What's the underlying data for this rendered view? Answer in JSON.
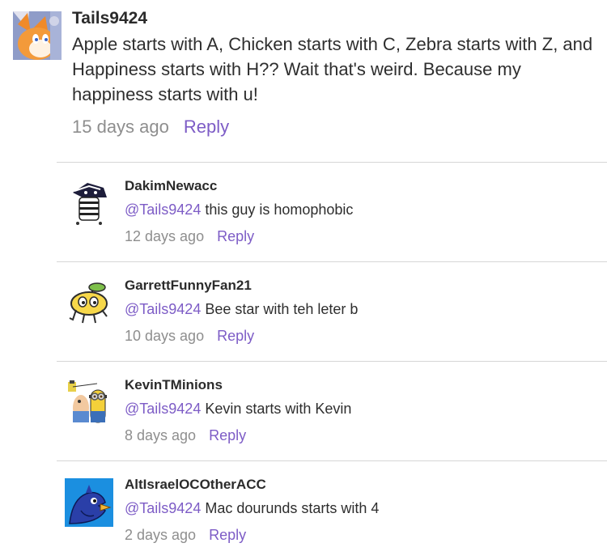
{
  "main_comment": {
    "username": "Tails9424",
    "text": "Apple starts with A, Chicken starts with C, Zebra starts with Z, and Happiness starts with H?? Wait that's weird. Because my happiness starts with u!",
    "time": "15 days ago",
    "reply_label": "Reply"
  },
  "replies": [
    {
      "username": "DakimNewacc",
      "mention": "@Tails9424",
      "text": " this guy is homophobic",
      "time": "12 days ago",
      "reply_label": "Reply"
    },
    {
      "username": "GarrettFunnyFan21",
      "mention": "@Tails9424",
      "text": " Bee star with teh leter b",
      "time": "10 days ago",
      "reply_label": "Reply"
    },
    {
      "username": "KevinTMinions",
      "mention": "@Tails9424",
      "text": " Kevin starts with Kevin",
      "time": "8 days ago",
      "reply_label": "Reply"
    },
    {
      "username": "AltIsraelOCOtherACC",
      "mention": "@Tails9424",
      "text": " Mac dourunds starts with 4",
      "time": "2 days ago",
      "reply_label": "Reply"
    }
  ],
  "avatars": {
    "main": "fox-character-avatar",
    "reply1": "striped-creature-avatar",
    "reply2": "yellow-fruit-character-avatar",
    "reply3": "minion-avatar",
    "reply4": "blue-bird-avatar"
  },
  "colors": {
    "link": "#7d5cc6",
    "meta": "#8e8e8e",
    "divider": "#d6d6d6"
  }
}
